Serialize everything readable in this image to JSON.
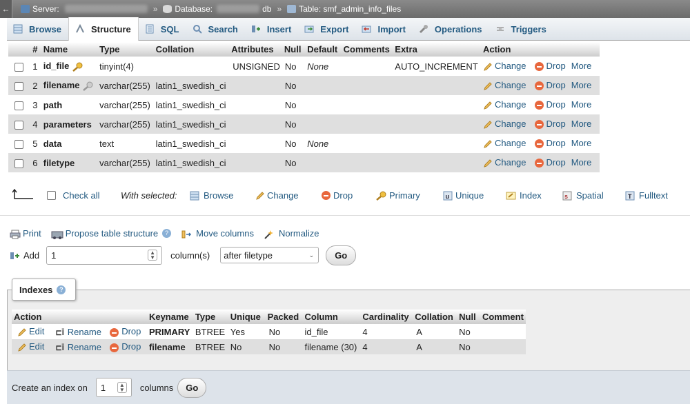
{
  "breadcrumb": {
    "server_label": "Server:",
    "database_label": "Database:",
    "database_suffix": "db",
    "table_label": "Table: smf_admin_info_files",
    "separator": "»"
  },
  "tabs": [
    {
      "label": "Browse",
      "icon": "browse-icon"
    },
    {
      "label": "Structure",
      "icon": "structure-icon",
      "active": true
    },
    {
      "label": "SQL",
      "icon": "sql-icon"
    },
    {
      "label": "Search",
      "icon": "search-icon"
    },
    {
      "label": "Insert",
      "icon": "insert-icon"
    },
    {
      "label": "Export",
      "icon": "export-icon"
    },
    {
      "label": "Import",
      "icon": "import-icon"
    },
    {
      "label": "Operations",
      "icon": "wrench-icon"
    },
    {
      "label": "Triggers",
      "icon": "triggers-icon"
    }
  ],
  "structure": {
    "headers": [
      "#",
      "Name",
      "Type",
      "Collation",
      "Attributes",
      "Null",
      "Default",
      "Comments",
      "Extra",
      "Action"
    ],
    "rows": [
      {
        "num": "1",
        "name": "id_file",
        "primary_key": true,
        "type": "tinyint(4)",
        "collation": "",
        "attributes": "UNSIGNED",
        "null": "No",
        "default": "None",
        "comments": "",
        "extra": "AUTO_INCREMENT"
      },
      {
        "num": "2",
        "name": "filename",
        "index_key": true,
        "type": "varchar(255)",
        "collation": "latin1_swedish_ci",
        "attributes": "",
        "null": "No",
        "default": "",
        "comments": "",
        "extra": ""
      },
      {
        "num": "3",
        "name": "path",
        "type": "varchar(255)",
        "collation": "latin1_swedish_ci",
        "attributes": "",
        "null": "No",
        "default": "",
        "comments": "",
        "extra": ""
      },
      {
        "num": "4",
        "name": "parameters",
        "type": "varchar(255)",
        "collation": "latin1_swedish_ci",
        "attributes": "",
        "null": "No",
        "default": "",
        "comments": "",
        "extra": ""
      },
      {
        "num": "5",
        "name": "data",
        "type": "text",
        "collation": "latin1_swedish_ci",
        "attributes": "",
        "null": "No",
        "default": "None",
        "comments": "",
        "extra": ""
      },
      {
        "num": "6",
        "name": "filetype",
        "type": "varchar(255)",
        "collation": "latin1_swedish_ci",
        "attributes": "",
        "null": "No",
        "default": "",
        "comments": "",
        "extra": ""
      }
    ],
    "actions": {
      "change": "Change",
      "drop": "Drop",
      "more": "More"
    }
  },
  "with_selected": {
    "check_all": "Check all",
    "label": "With selected:",
    "browse": "Browse",
    "change": "Change",
    "drop": "Drop",
    "primary": "Primary",
    "unique": "Unique",
    "index": "Index",
    "spatial": "Spatial",
    "fulltext": "Fulltext"
  },
  "tools": {
    "print": "Print",
    "propose": "Propose table structure",
    "move_columns": "Move columns",
    "normalize": "Normalize"
  },
  "add_columns": {
    "label": "Add",
    "count": "1",
    "columns_label": "column(s)",
    "position": "after filetype",
    "go": "Go"
  },
  "indexes": {
    "legend": "Indexes",
    "headers": [
      "Action",
      "",
      "",
      "Keyname",
      "Type",
      "Unique",
      "Packed",
      "Column",
      "Cardinality",
      "Collation",
      "Null",
      "Comment"
    ],
    "edit": "Edit",
    "rename": "Rename",
    "drop": "Drop",
    "rows": [
      {
        "keyname": "PRIMARY",
        "type": "BTREE",
        "unique": "Yes",
        "packed": "No",
        "column": "id_file",
        "cardinality": "4",
        "collation": "A",
        "null": "No",
        "comment": ""
      },
      {
        "keyname": "filename",
        "type": "BTREE",
        "unique": "No",
        "packed": "No",
        "column": "filename (30)",
        "cardinality": "4",
        "collation": "A",
        "null": "No",
        "comment": ""
      }
    ]
  },
  "create_index": {
    "label": "Create an index on",
    "count": "1",
    "columns_label": "columns",
    "go": "Go"
  }
}
